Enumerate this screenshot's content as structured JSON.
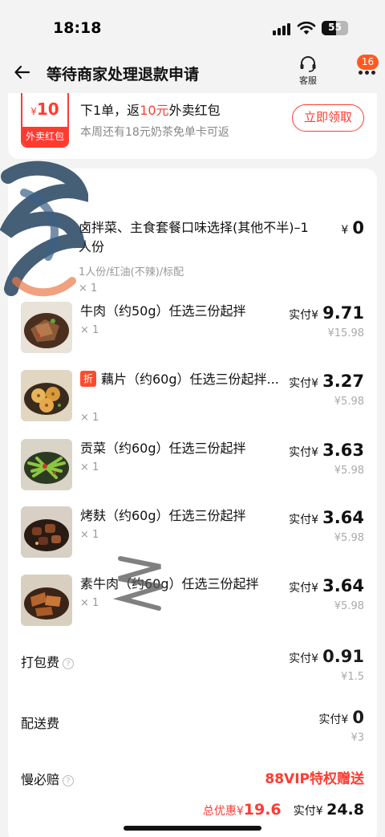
{
  "status_bar": {
    "time": "18:18",
    "battery": "55"
  },
  "nav": {
    "title": "等待商家处理退款申请",
    "customer_service": "客服",
    "badge": "16"
  },
  "coupon": {
    "amount": "10",
    "currency": "¥",
    "tag": "外卖红包",
    "line1_pre": "下1单，返",
    "line1_hl": "10元",
    "line1_post": "外卖红包",
    "line2": "本周还有18元奶茶免单卡可返",
    "button": "立即领取"
  },
  "items": [
    {
      "name": "卤拌菜、主食套餐口味选择(其他不半)–1人份",
      "spec": "1人份/红油(不辣)/标配",
      "qty": "× 1",
      "price": "0",
      "paid_label": "",
      "orig": ""
    },
    {
      "name": "牛肉（约50g）任选三份起拌",
      "qty": "× 1",
      "paid_label": "实付",
      "price": "9.71",
      "orig": "¥15.98"
    },
    {
      "name": "藕片（约60g）任选三份起拌...",
      "discount_tag": "折",
      "qty": "× 1",
      "paid_label": "实付",
      "price": "3.27",
      "orig": "¥5.98"
    },
    {
      "name": "贡菜（约60g）任选三份起拌",
      "qty": "× 1",
      "paid_label": "实付",
      "price": "3.63",
      "orig": "¥5.98"
    },
    {
      "name": "烤麸（约60g）任选三份起拌",
      "qty": "× 1",
      "paid_label": "实付",
      "price": "3.64",
      "orig": "¥5.98"
    },
    {
      "name": "素牛肉（约60g）任选三份起拌",
      "qty": "× 1",
      "paid_label": "实付",
      "price": "3.64",
      "orig": "¥5.98"
    }
  ],
  "fees": {
    "packing": {
      "label": "打包费",
      "paid_label": "实付",
      "price": "0.91",
      "orig": "¥1.5"
    },
    "delivery": {
      "label": "配送费",
      "paid_label": "实付",
      "price": "0",
      "orig": "¥3"
    },
    "guarantee": {
      "label": "慢必赔",
      "value": "88VIP特权赠送"
    }
  },
  "summary": {
    "discount_label": "总优惠",
    "discount": "19.6",
    "paid_label": "实付",
    "paid": "24.8"
  },
  "currency": "¥",
  "colors": {
    "accent": "#ff3b30",
    "badge": "#ff5a1f"
  }
}
